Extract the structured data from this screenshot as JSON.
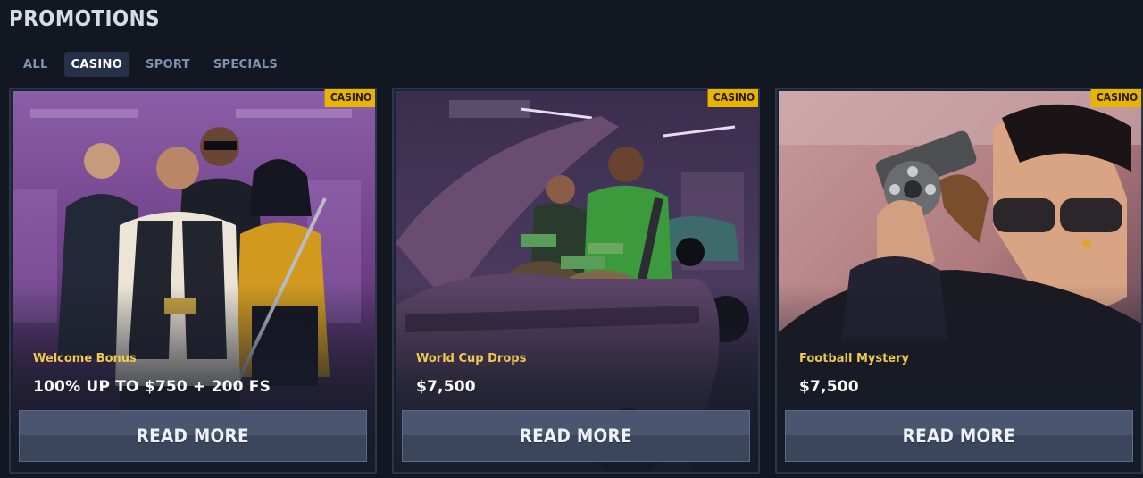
{
  "page": {
    "title": "PROMOTIONS"
  },
  "tabs": [
    {
      "label": "ALL",
      "active": false
    },
    {
      "label": "CASINO",
      "active": true
    },
    {
      "label": "SPORT",
      "active": false
    },
    {
      "label": "SPECIALS",
      "active": false
    }
  ],
  "cards": [
    {
      "badge": "CASINO",
      "name": "Welcome Bonus",
      "value": "100% UP TO $750 + 200 FS",
      "button": "READ MORE",
      "art": "gangster-crew-illustration"
    },
    {
      "badge": "CASINO",
      "name": "World Cup Drops",
      "value": "$7,500",
      "button": "READ MORE",
      "art": "car-trunk-money-illustration"
    },
    {
      "badge": "CASINO",
      "name": "Football Mystery",
      "value": "$7,500",
      "button": "READ MORE",
      "art": "revolver-gangster-illustration"
    }
  ],
  "colors": {
    "background": "#121722",
    "badge": "#e7b500",
    "promo_name": "#f0c84b",
    "active_tab": "#263046",
    "button": "#4a5670"
  }
}
